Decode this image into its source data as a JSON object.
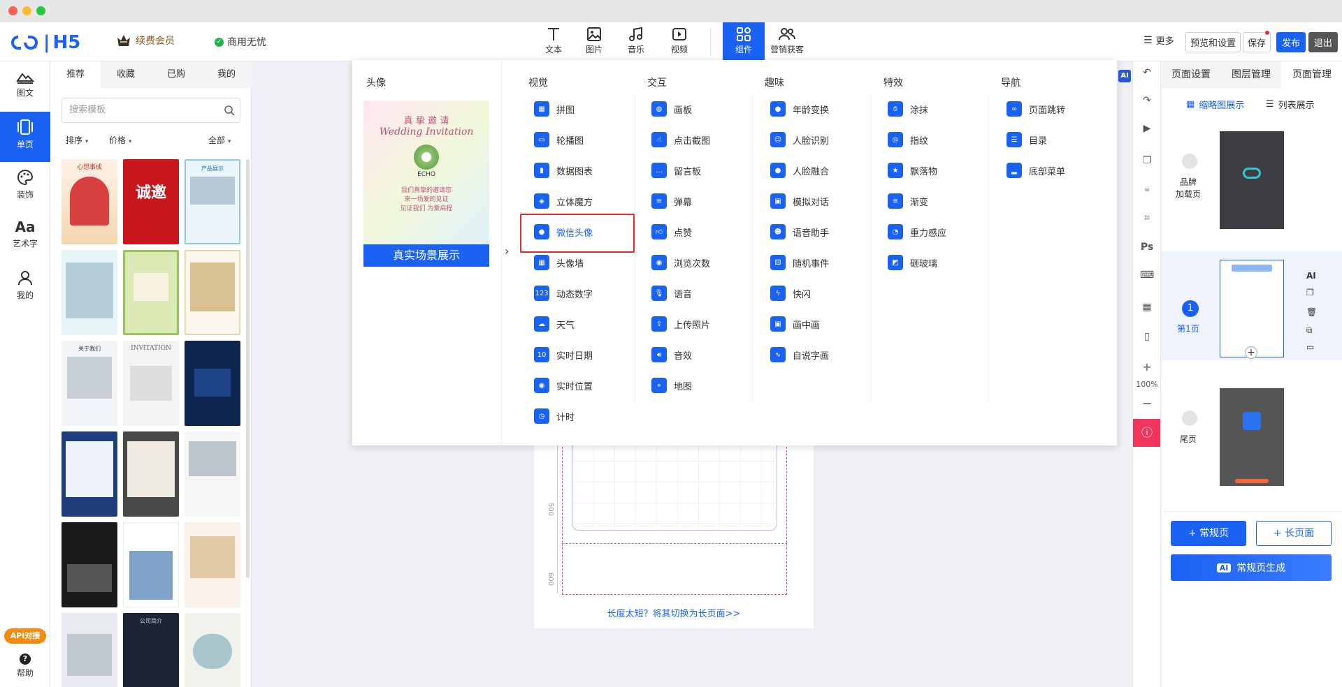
{
  "header": {
    "logo": "H5",
    "vip_label": "续费会员",
    "commercial_label": "商用无忧",
    "tools": [
      {
        "label": "文本",
        "icon": "text-icon"
      },
      {
        "label": "图片",
        "icon": "image-icon"
      },
      {
        "label": "音乐",
        "icon": "music-icon"
      },
      {
        "label": "视频",
        "icon": "video-icon"
      },
      {
        "label": "组件",
        "icon": "component-icon"
      },
      {
        "label": "营销获客",
        "icon": "users-icon"
      }
    ],
    "more": "更多",
    "preview_settings": "预览和设置",
    "save": "保存",
    "publish": "发布",
    "exit": "退出"
  },
  "left_nav": {
    "items": [
      {
        "label": "图文",
        "icon": "mountain-icon"
      },
      {
        "label": "单页",
        "icon": "page-icon"
      },
      {
        "label": "装饰",
        "icon": "palette-icon"
      },
      {
        "label": "艺术字",
        "icon": "art-text-icon"
      },
      {
        "label": "我的",
        "icon": "user-icon"
      }
    ],
    "api_label": "API对接",
    "help_label": "帮助"
  },
  "templates": {
    "tabs": [
      "推荐",
      "收藏",
      "已购",
      "我的"
    ],
    "search_placeholder": "搜索模板",
    "sort": "排序",
    "price": "价格",
    "all": "全部",
    "thumb_texts": [
      "心想事成",
      "诚邀",
      "产品展示",
      "关于我们",
      "INVITATION",
      "公司简介"
    ]
  },
  "dropdown": {
    "avatar_title": "头像",
    "preview": {
      "line1": "真 挚 邀 请",
      "line2": "Wedding Invitation",
      "name": "ECHO",
      "text1": "我们真挚的邀请您",
      "text2": "来一场爱的见证",
      "text3": "见证我们 为爱启程",
      "button": "真实场景展示"
    },
    "categories": [
      {
        "title": "视觉",
        "items": [
          "拼图",
          "轮播图",
          "数据图表",
          "立体魔方",
          "微信头像",
          "头像墙",
          "动态数字",
          "天气",
          "实时日期",
          "实时位置",
          "计时"
        ]
      },
      {
        "title": "交互",
        "items": [
          "画板",
          "点击截图",
          "留言板",
          "弹幕",
          "点赞",
          "浏览次数",
          "语音",
          "上传照片",
          "音效",
          "地图"
        ]
      },
      {
        "title": "趣味",
        "items": [
          "年龄变换",
          "人脸识别",
          "人脸融合",
          "模拟对话",
          "语音助手",
          "随机事件",
          "快闪",
          "画中画",
          "自说字画"
        ]
      },
      {
        "title": "特效",
        "items": [
          "涂抹",
          "指纹",
          "飘落物",
          "渐变",
          "重力感应",
          "砸玻璃"
        ]
      },
      {
        "title": "导航",
        "items": [
          "页面跳转",
          "目录",
          "底部菜单"
        ]
      }
    ],
    "highlighted": "微信头像"
  },
  "canvas": {
    "ruler_500": "500",
    "ruler_600": "600",
    "switch_link": "长度太短？将其切换为长页面>>"
  },
  "right_toolbar": {
    "ps": "Ps",
    "zoom": "100%"
  },
  "right_panel": {
    "tabs": [
      "页面设置",
      "图层管理",
      "页面管理"
    ],
    "view_thumb": "缩略图展示",
    "view_list": "列表展示",
    "pages": [
      {
        "label": "品牌\n加载页",
        "badge": ""
      },
      {
        "label": "第1页",
        "badge": "1"
      },
      {
        "label": "尾页",
        "badge": ""
      }
    ],
    "ai_label": "AI",
    "add_normal": "+ 常规页",
    "add_long": "+ 长页面",
    "ai_generate": "常规页生成"
  }
}
